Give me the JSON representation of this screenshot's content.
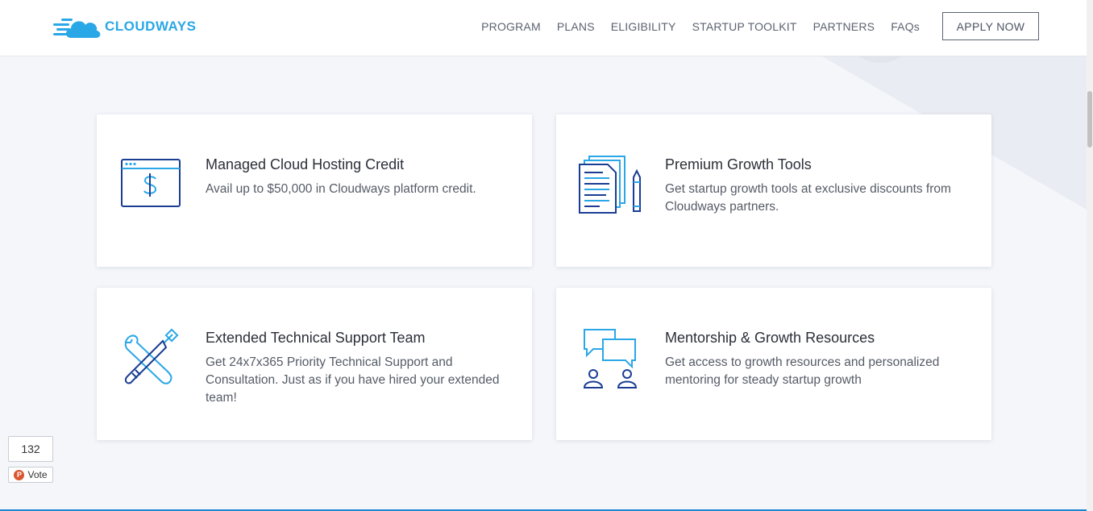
{
  "brand": {
    "name": "CLOUDWAYS",
    "accent": "#2aa7e6",
    "icon": "cloud-logo-icon"
  },
  "nav": {
    "items": [
      {
        "label": "PROGRAM"
      },
      {
        "label": "PLANS"
      },
      {
        "label": "ELIGIBILITY"
      },
      {
        "label": "STARTUP TOOLKIT"
      },
      {
        "label": "PARTNERS"
      },
      {
        "label": "FAQs"
      }
    ],
    "apply_label": "APPLY NOW"
  },
  "cards": [
    {
      "icon": "browser-dollar-icon",
      "title": "Managed Cloud Hosting Credit",
      "desc": "Avail up to $50,000 in Cloudways platform credit."
    },
    {
      "icon": "documents-pencil-icon",
      "title": "Premium Growth Tools",
      "desc": "Get startup growth tools at exclusive discounts from Cloudways partners."
    },
    {
      "icon": "wrench-screwdriver-icon",
      "title": "Extended Technical Support Team",
      "desc": "Get 24x7x365 Priority Technical Support and Consultation. Just as if you have hired your extended team!"
    },
    {
      "icon": "chat-people-icon",
      "title": "Mentorship & Growth Resources",
      "desc": "Get access to growth resources and personalized mentoring for steady startup growth"
    }
  ],
  "vote_widget": {
    "count": "132",
    "label": "Vote",
    "icon": "product-hunt-icon",
    "icon_letter": "P"
  },
  "colors": {
    "icon_dark": "#1a3d93",
    "icon_light": "#2aa7e6",
    "bottom_line": "#1b86d1"
  }
}
